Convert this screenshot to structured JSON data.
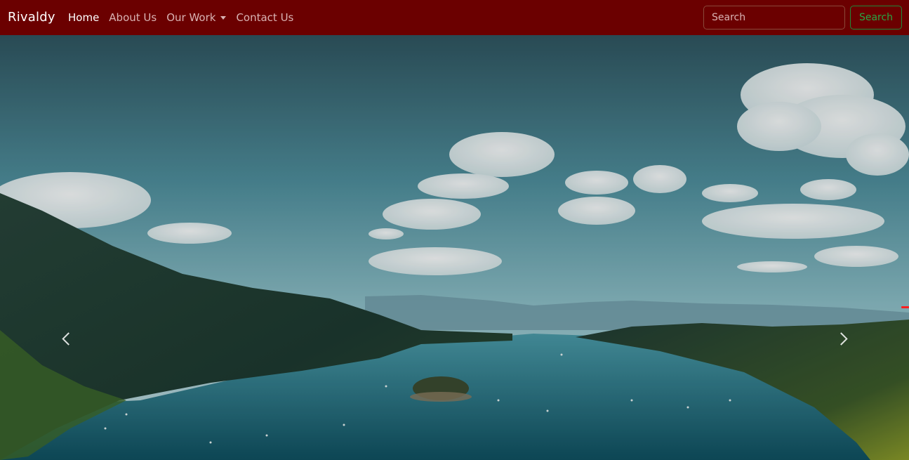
{
  "navbar": {
    "brand": "Rivaldy",
    "items": [
      {
        "label": "Home",
        "active": true
      },
      {
        "label": "About Us",
        "active": false
      },
      {
        "label": "Our Work",
        "active": false,
        "dropdown": true
      },
      {
        "label": "Contact Us",
        "active": false
      }
    ],
    "search": {
      "placeholder": "Search",
      "button_label": "Search"
    },
    "background_color": "#6b0000"
  },
  "hero": {
    "image_subject": "aerial view of a blue lake with forested hills and an island under a cloudy sky",
    "controls": {
      "prev_icon": "chevron-left-icon",
      "next_icon": "chevron-right-icon"
    }
  }
}
